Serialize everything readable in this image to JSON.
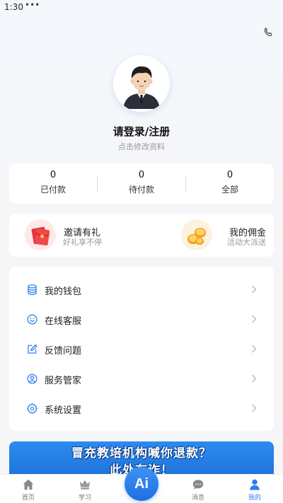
{
  "status_bar": {
    "time": "1:30",
    "dots": "•••"
  },
  "header": {
    "phone_icon": "phone-icon"
  },
  "profile": {
    "name": "请登录/注册",
    "subtitle": "点击修改资料"
  },
  "orders": [
    {
      "count": "0",
      "label": "已付款"
    },
    {
      "count": "0",
      "label": "待付款"
    },
    {
      "count": "0",
      "label": "全部"
    }
  ],
  "promos": [
    {
      "title": "邀请有礼",
      "subtitle": "好礼享不停",
      "icon": "red-envelope-icon"
    },
    {
      "title": "我的佣金",
      "subtitle": "活动大派送",
      "icon": "coins-icon"
    }
  ],
  "menu": [
    {
      "label": "我的钱包",
      "icon": "wallet-icon"
    },
    {
      "label": "在线客服",
      "icon": "smile-icon"
    },
    {
      "label": "反馈问题",
      "icon": "edit-icon"
    },
    {
      "label": "服务管家",
      "icon": "user-circle-icon"
    },
    {
      "label": "系统设置",
      "icon": "gear-icon"
    }
  ],
  "banner": {
    "line1": "冒充教培机构喊你退款？",
    "line2": "此处有诈！"
  },
  "tabbar": {
    "tabs": [
      {
        "label": "首页",
        "icon": "home-icon"
      },
      {
        "label": "学习",
        "icon": "vip-crown-icon"
      },
      {
        "label": "消息",
        "icon": "message-icon"
      },
      {
        "label": "我的",
        "icon": "profile-icon"
      }
    ],
    "ai_label": "Ai"
  },
  "colors": {
    "accent": "#2f7ff0",
    "menu_icon": "#2f7ff0",
    "tab_inactive": "#777777"
  }
}
